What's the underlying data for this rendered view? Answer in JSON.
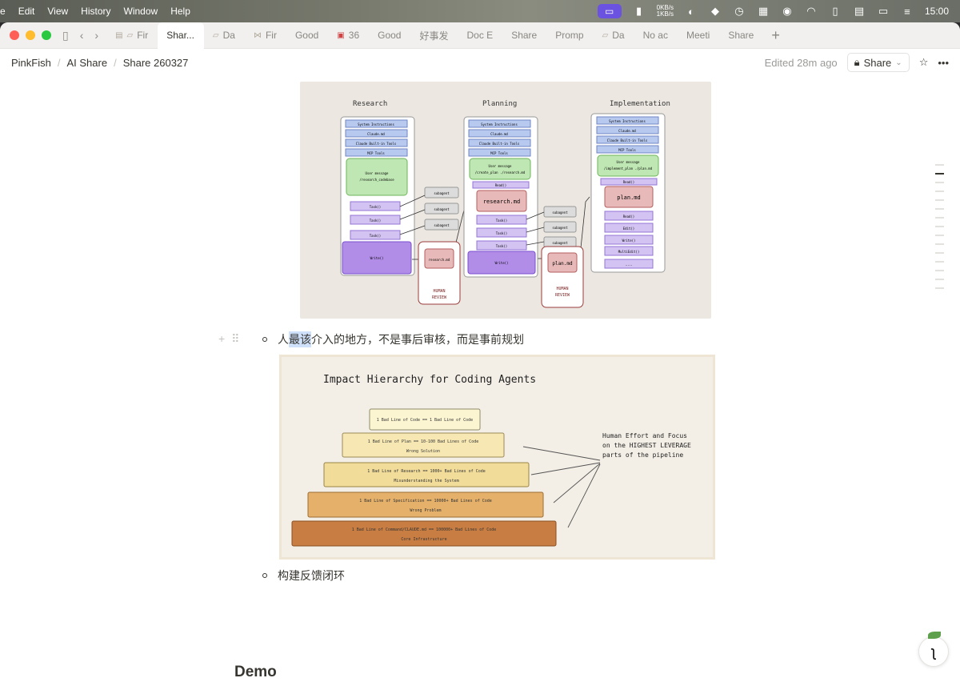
{
  "menubar": {
    "items": [
      "e",
      "Edit",
      "View",
      "History",
      "Window",
      "Help"
    ],
    "net_up": "0KB/s",
    "net_down": "1KB/s",
    "time": "15:00"
  },
  "tabs": [
    {
      "label": "Fir",
      "icon": "page-icon"
    },
    {
      "label": "Shar...",
      "icon": "none",
      "active": true
    },
    {
      "label": "Da",
      "icon": "page-icon"
    },
    {
      "label": "Fir",
      "icon": "page-icon"
    },
    {
      "label": "Good",
      "icon": "none"
    },
    {
      "label": "36",
      "icon": "page-icon"
    },
    {
      "label": "Good",
      "icon": "none"
    },
    {
      "label": "好事发",
      "icon": "none"
    },
    {
      "label": "Doc E",
      "icon": "none"
    },
    {
      "label": "Share",
      "icon": "none"
    },
    {
      "label": "Promp",
      "icon": "none"
    },
    {
      "label": "Da",
      "icon": "page-icon"
    },
    {
      "label": "No ac",
      "icon": "none"
    },
    {
      "label": "Meeti",
      "icon": "none"
    },
    {
      "label": "Share",
      "icon": "none"
    }
  ],
  "breadcrumb": [
    "PinkFish",
    "AI Share",
    "Share 260327"
  ],
  "topbar": {
    "edited": "Edited 28m ago",
    "share": "Share"
  },
  "content": {
    "bullet1_pre": "人",
    "bullet1_hl": "最该",
    "bullet1_post": "介入的地方，不是事后审核，而是事前规划",
    "bullet2": "构建反馈闭环",
    "heading": "Demo"
  },
  "diagram1": {
    "col_research": "Research",
    "col_planning": "Planning",
    "col_impl": "Implementation",
    "system_instructions": "System Instructions",
    "claude_md": "Claude.md",
    "builtin_tools": "Claude Built-in Tools",
    "mcp_tools": "MCP Tools",
    "user_message": "User message",
    "research_cmd": "/research_codebase",
    "plan_cmd": "/create_plan ./research.md",
    "impl_cmd": "/implement_plan ./plan.md",
    "task": "Task()",
    "write": "Write()",
    "read": "Read()",
    "edit": "Edit()",
    "multiedit": "MultiEdit()",
    "more": "...",
    "subagent": "subagent",
    "research_md": "research.md",
    "plan_md": "plan.md",
    "human": "HUMAN",
    "review": "REVIEW"
  },
  "diagram2": {
    "title": "Impact Hierarchy for Coding Agents",
    "levels": [
      {
        "line1": "1 Bad Line of Code == 1 Bad Line of Code",
        "line2": ""
      },
      {
        "line1": "1 Bad Line of Plan == 10-100 Bad Lines of Code",
        "line2": "Wrong Solution"
      },
      {
        "line1": "1 Bad Line of Research == 1000+ Bad Lines of Code",
        "line2": "Misunderstanding the System"
      },
      {
        "line1": "1 Bad Line of Specification == 10000+ Bad Lines of Code",
        "line2": "Wrong Problem"
      },
      {
        "line1": "1 Bad Line of Command/CLAUDE.md == 100000+ Bad Lines of Code",
        "line2": "Core Infrastructure"
      }
    ],
    "note1": "Human Effort and Focus",
    "note2": "on the HIGHEST LEVERAGE",
    "note3": "parts of the pipeline"
  }
}
